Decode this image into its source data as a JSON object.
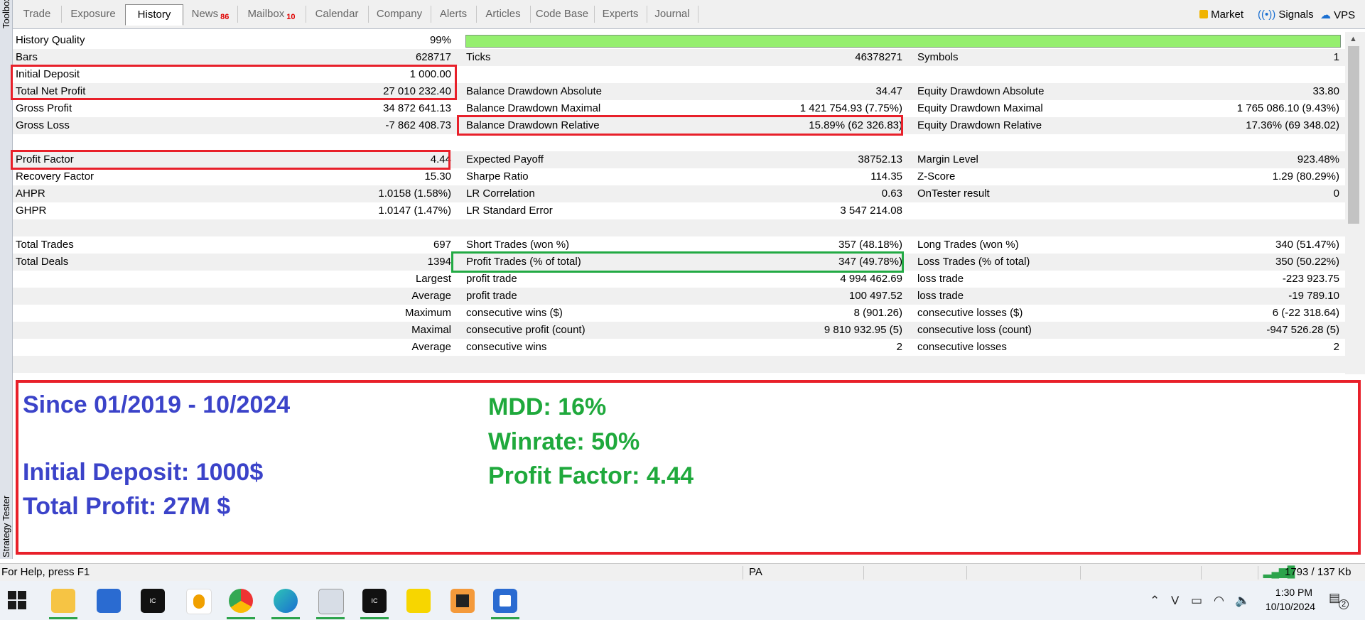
{
  "left_strip": {
    "toolbox_label": "Toolbox",
    "strategy_label": "Strategy Tester"
  },
  "tabs": [
    {
      "label": "Trade"
    },
    {
      "label": "Exposure"
    },
    {
      "label": "History"
    },
    {
      "label": "News",
      "badge": "86"
    },
    {
      "label": "Mailbox",
      "badge": "10"
    },
    {
      "label": "Calendar"
    },
    {
      "label": "Company"
    },
    {
      "label": "Alerts"
    },
    {
      "label": "Articles"
    },
    {
      "label": "Code Base"
    },
    {
      "label": "Experts"
    },
    {
      "label": "Journal"
    }
  ],
  "right_links": {
    "market": "Market",
    "signals": "Signals",
    "vps": "VPS"
  },
  "report": {
    "history_quality": {
      "label": "History Quality",
      "value": "99%",
      "bar_fraction": 1.0
    },
    "bars": {
      "label": "Bars",
      "value": "628717"
    },
    "ticks": {
      "label": "Ticks",
      "value": "46378271"
    },
    "symbols": {
      "label": "Symbols",
      "value": "1"
    },
    "initial_deposit": {
      "label": "Initial Deposit",
      "value": "1 000.00"
    },
    "total_net_profit": {
      "label": "Total Net Profit",
      "value": "27 010 232.40"
    },
    "gross_profit": {
      "label": "Gross Profit",
      "value": "34 872 641.13"
    },
    "gross_loss": {
      "label": "Gross Loss",
      "value": "-7 862 408.73"
    },
    "bal_dd_abs": {
      "label": "Balance Drawdown Absolute",
      "value": "34.47"
    },
    "bal_dd_max": {
      "label": "Balance Drawdown Maximal",
      "value": "1 421 754.93 (7.75%)"
    },
    "bal_dd_rel": {
      "label": "Balance Drawdown Relative",
      "value": "15.89% (62 326.83)"
    },
    "eq_dd_abs": {
      "label": "Equity Drawdown Absolute",
      "value": "33.80"
    },
    "eq_dd_max": {
      "label": "Equity Drawdown Maximal",
      "value": "1 765 086.10 (9.43%)"
    },
    "eq_dd_rel": {
      "label": "Equity Drawdown Relative",
      "value": "17.36% (69 348.02)"
    },
    "profit_factor": {
      "label": "Profit Factor",
      "value": "4.44"
    },
    "recovery_factor": {
      "label": "Recovery Factor",
      "value": "15.30"
    },
    "ahpr": {
      "label": "AHPR",
      "value": "1.0158 (1.58%)"
    },
    "ghpr": {
      "label": "GHPR",
      "value": "1.0147 (1.47%)"
    },
    "expected_payoff": {
      "label": "Expected Payoff",
      "value": "38752.13"
    },
    "sharpe": {
      "label": "Sharpe Ratio",
      "value": "114.35"
    },
    "lr_corr": {
      "label": "LR Correlation",
      "value": "0.63"
    },
    "lr_err": {
      "label": "LR Standard Error",
      "value": "3 547 214.08"
    },
    "margin_level": {
      "label": "Margin Level",
      "value": "923.48%"
    },
    "z_score": {
      "label": "Z-Score",
      "value": "1.29 (80.29%)"
    },
    "ontester": {
      "label": "OnTester result",
      "value": "0"
    },
    "total_trades": {
      "label": "Total Trades",
      "value": "697"
    },
    "total_deals": {
      "label": "Total Deals",
      "value": "1394"
    },
    "short_trades": {
      "label": "Short Trades (won %)",
      "value": "357 (48.18%)"
    },
    "profit_trades": {
      "label": "Profit Trades (% of total)",
      "value": "347 (49.78%)"
    },
    "long_trades": {
      "label": "Long Trades (won %)",
      "value": "340 (51.47%)"
    },
    "loss_trades": {
      "label": "Loss Trades (% of total)",
      "value": "350 (50.22%)"
    },
    "rows": [
      {
        "prefix": "Largest",
        "l1": "profit trade",
        "v1": "4 994 462.69",
        "l2": "loss trade",
        "v2": "-223 923.75"
      },
      {
        "prefix": "Average",
        "l1": "profit trade",
        "v1": "100 497.52",
        "l2": "loss trade",
        "v2": "-19 789.10"
      },
      {
        "prefix": "Maximum",
        "l1": "consecutive wins ($)",
        "v1": "8 (901.26)",
        "l2": "consecutive losses ($)",
        "v2": "6 (-22 318.64)"
      },
      {
        "prefix": "Maximal",
        "l1": "consecutive profit (count)",
        "v1": "9 810 932.95 (5)",
        "l2": "consecutive loss (count)",
        "v2": "-947 526.28 (5)"
      },
      {
        "prefix": "Average",
        "l1": "consecutive wins",
        "v1": "2",
        "l2": "consecutive losses",
        "v2": "2"
      }
    ]
  },
  "summary": {
    "period": "Since 01/2019 - 10/2024",
    "initial_deposit": "Initial Deposit:  1000$",
    "total_profit": "Total Profit: 27M $",
    "mdd": "MDD: 16%",
    "winrate": "Winrate:  50%",
    "profit_factor": "Profit Factor: 4.44"
  },
  "status_bar": {
    "help": "For Help, press F1",
    "profile": "PA",
    "traffic": "1793 / 137 Kb"
  },
  "taskbar": {
    "time": "1:30 PM",
    "date": "10/10/2024",
    "notification_count": "2"
  }
}
